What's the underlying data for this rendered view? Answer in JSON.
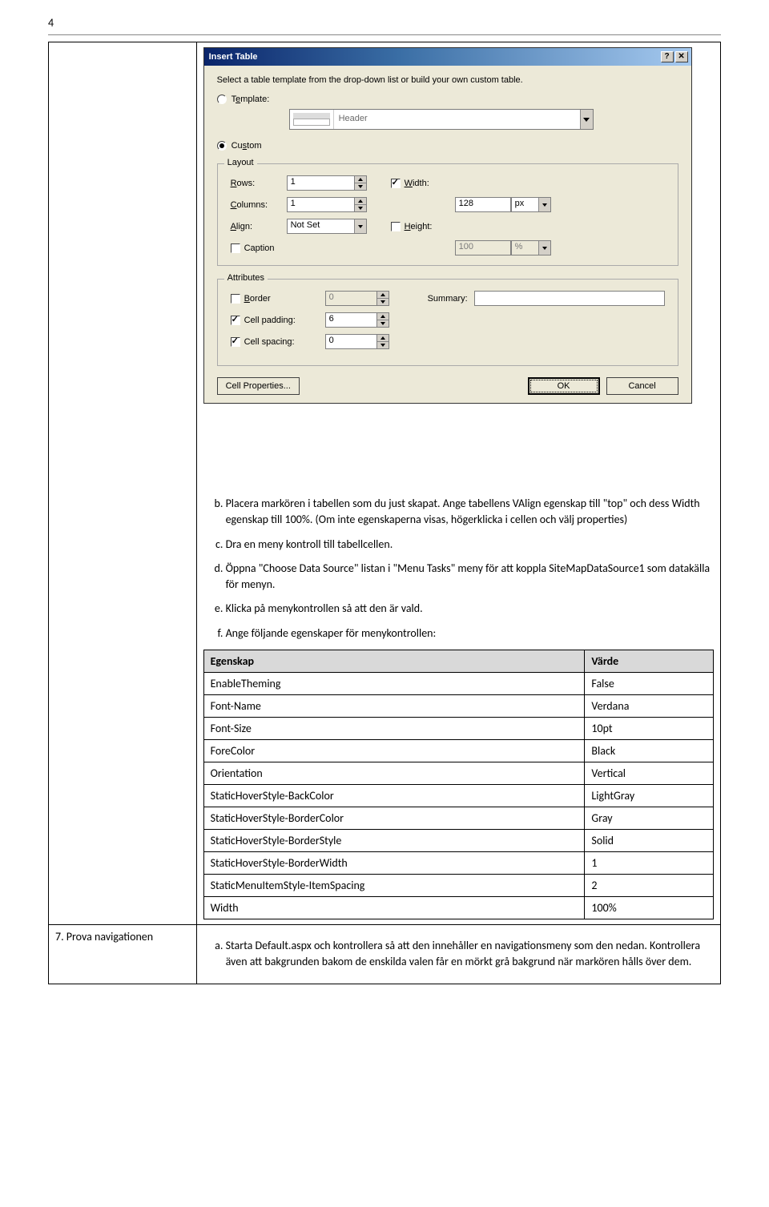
{
  "pageNumber": "4",
  "dialog": {
    "title": "Insert Table",
    "intro": "Select a table template from the drop-down list or build your own custom table.",
    "templateLabelPre": "T",
    "templateLabelU": "e",
    "templateLabelPost": "mplate:",
    "templatePlaceholder": "Header",
    "customLabelPre": "Cu",
    "customLabelU": "s",
    "customLabelPost": "tom",
    "layout": {
      "legend": "Layout",
      "rowsLabelU": "R",
      "rowsLabelPost": "ows:",
      "rowsValue": "1",
      "colsLabelU": "C",
      "colsLabelPost": "olumns:",
      "colsValue": "1",
      "alignLabelU": "A",
      "alignLabelPost": "lign:",
      "alignValue": "Not Set",
      "captionLabel": "Caption",
      "widthLabelU": "W",
      "widthLabelPost": "idth:",
      "widthValue": "128",
      "widthUnit": "px",
      "heightLabelU": "H",
      "heightLabelPost": "eight:",
      "heightValue": "100",
      "heightUnit": "%"
    },
    "attributes": {
      "legend": "Attributes",
      "borderLabelU": "B",
      "borderLabelPost": "order",
      "borderValue": "0",
      "cellPaddingLabel": "Cell padding:",
      "cellPaddingValue": "6",
      "cellSpacingLabel": "Cell spacing:",
      "cellSpacingValue": "0",
      "summaryLabel": "Summary:"
    },
    "buttons": {
      "cellProps": "Cell Properties...",
      "ok": "OK",
      "cancel": "Cancel"
    }
  },
  "steps": {
    "b": "Placera markören i tabellen som du just skapat. Ange tabellens VAlign egenskap till \"top\" och dess Width egenskap till 100%. (Om inte egenskaperna visas, högerklicka i cellen och välj properties)",
    "c": "Dra en meny kontroll till tabellcellen.",
    "d": "Öppna \"Choose Data Source\" listan i \"Menu Tasks\" meny för att koppla SiteMapDataSource1 som datakälla för menyn.",
    "e": "Klicka på menykontrollen så att den är vald.",
    "f": "Ange följande egenskaper för menykontrollen:"
  },
  "propTable": {
    "headerProp": "Egenskap",
    "headerVal": "Värde",
    "rows": [
      {
        "p": "EnableTheming",
        "v": "False"
      },
      {
        "p": "Font-Name",
        "v": "Verdana"
      },
      {
        "p": "Font-Size",
        "v": "10pt"
      },
      {
        "p": "ForeColor",
        "v": "Black"
      },
      {
        "p": "Orientation",
        "v": "Vertical"
      },
      {
        "p": "StaticHoverStyle-BackColor",
        "v": "LightGray"
      },
      {
        "p": "StaticHoverStyle-BorderColor",
        "v": "Gray"
      },
      {
        "p": "StaticHoverStyle-BorderStyle",
        "v": "Solid"
      },
      {
        "p": "StaticHoverStyle-BorderWidth",
        "v": "1"
      },
      {
        "p": "StaticMenuItemStyle-ItemSpacing",
        "v": "2"
      },
      {
        "p": "Width",
        "v": "100%"
      }
    ]
  },
  "section7": {
    "left": "7.  Prova navigationen",
    "a": "Starta Default.aspx och kontrollera så att den innehåller en navigationsmeny som den nedan. Kontrollera även att bakgrunden bakom de enskilda valen får en mörkt grå bakgrund när markören hålls över dem."
  }
}
